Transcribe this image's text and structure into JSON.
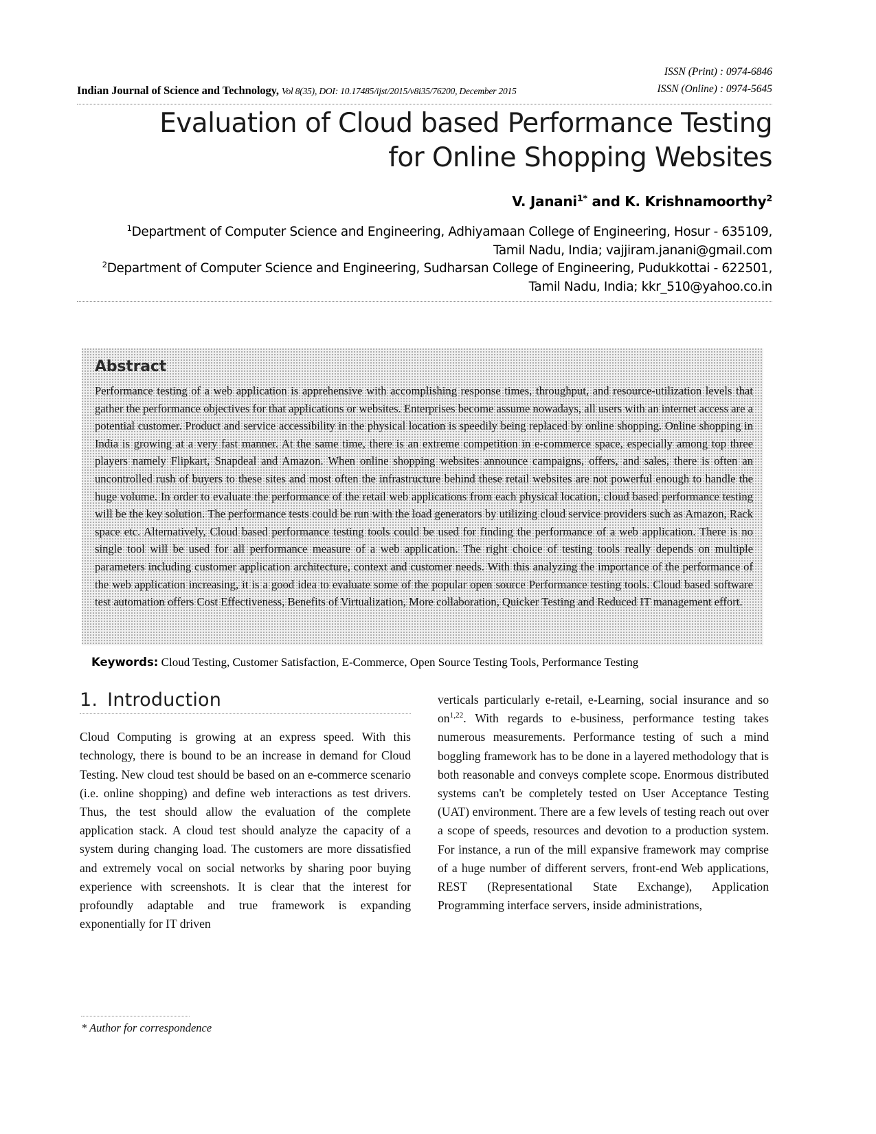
{
  "masthead": {
    "journal_name": "Indian Journal of Science and Technology,",
    "journal_meta": "Vol 8(35), DOI: 10.17485/ijst/2015/v8i35/76200, December 2015",
    "issn_print": "ISSN (Print) : 0974-6846",
    "issn_online": "ISSN (Online) : 0974-5645"
  },
  "title": {
    "line1": "Evaluation of Cloud based Performance Testing",
    "line2": "for Online Shopping Websites"
  },
  "authors": {
    "line": "V. Janani1* and K. Krishnamoorthy2"
  },
  "affiliations": {
    "line1": "1Department of Computer Science and Engineering, Adhiyamaan College of Engineering, Hosur - 635109,",
    "line2": "Tamil Nadu, India; vajjiram.janani@gmail.com",
    "line3": "2Department of Computer Science and Engineering, Sudharsan College of Engineering, Pudukkottai - 622501,",
    "line4": "Tamil Nadu, India; kkr_510@yahoo.co.in"
  },
  "abstract": {
    "heading": "Abstract",
    "body": "Performance testing of a web application is apprehensive with accomplishing response times, throughput, and resource-utilization levels that gather the performance objectives for that applications or websites. Enterprises become assume nowadays, all users with an internet access are a potential customer. Product and service accessibility in the physical location is speedily being replaced by online shopping. Online shopping in India is growing at a very fast manner. At the same time, there is an extreme competition in e-commerce space, especially among top three players namely Flipkart, Snapdeal and Amazon. When online shopping websites announce campaigns, offers, and sales, there is often an uncontrolled rush of buyers to these sites and most often the infrastructure behind these retail websites are not powerful enough to handle the huge volume. In order to evaluate the performance of the retail web applications from each physical location, cloud based performance testing will be the key solution. The performance tests could be run with the load generators by utilizing cloud service providers such as Amazon, Rack space etc. Alternatively, Cloud based performance testing tools could be used for finding the performance of a web application. There is no single tool will be used for all performance measure of a web application. The right choice of testing tools really depends on multiple parameters including customer application architecture, context and customer needs. With this analyzing the importance of the performance of the web application increasing, it is a good idea to evaluate some of the popular open source Performance testing tools. Cloud based software test automation offers Cost Effectiveness, Benefits of Virtualization, More collaboration, Quicker Testing and Reduced IT management effort."
  },
  "keywords": {
    "label": "Keywords:",
    "value": "Cloud Testing, Customer Satisfaction, E-Commerce, Open Source Testing Tools, Performance Testing"
  },
  "section": {
    "number": "1.",
    "title": "Introduction"
  },
  "columns": {
    "left": "Cloud Computing is growing at an express speed. With this technology, there is bound to be an increase in demand for Cloud Testing. New cloud test should be based on an e-commerce scenario (i.e. online shopping) and define web interactions as test drivers. Thus, the test should allow the evaluation of the complete application stack. A cloud test should analyze the capacity of a system during changing load. The customers are more dissatisfied and extremely vocal on social networks by sharing poor buying experience with screenshots. It is clear that the interest for profoundly adaptable and true framework is expanding exponentially for IT driven",
    "right": "verticals particularly e-retail, e-Learning, social insurance and so on1,22. With regards to e-business, performance testing takes numerous measurements. Performance testing of such a mind boggling framework has to be done in a layered methodology that is both reasonable and conveys complete scope. Enormous distributed systems can't be completely tested on User Acceptance Testing (UAT) environment. There are a few levels of testing reach out over a scope of speeds, resources and devotion to a production system. For instance, a run of the mill expansive framework may comprise of a huge number of different servers, front-end Web applications, REST (Representational State Exchange), Application Programming interface servers, inside administrations,"
  },
  "footer": {
    "note": "* Author for correspondence"
  }
}
